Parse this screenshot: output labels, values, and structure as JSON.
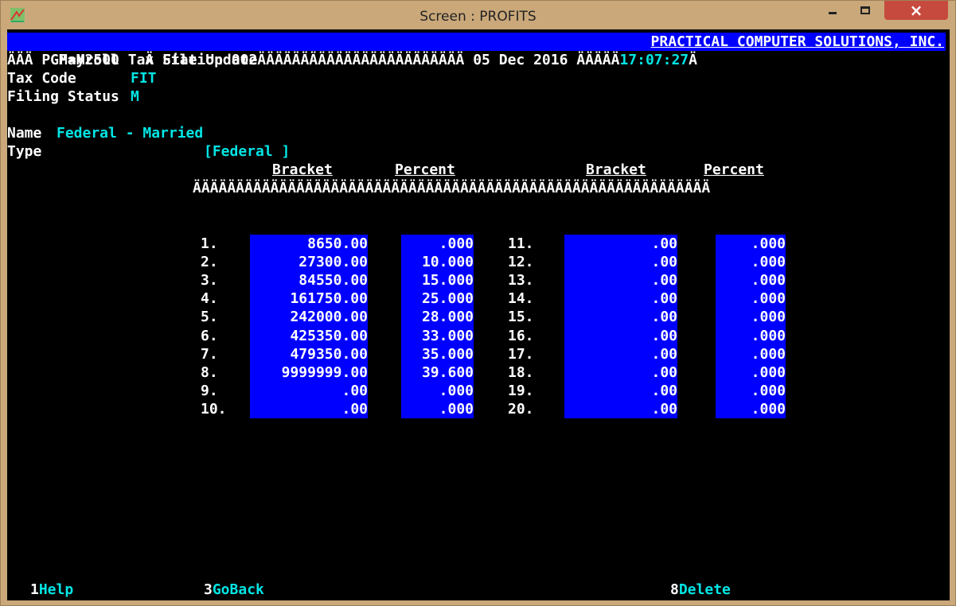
{
  "window": {
    "title": "Screen : PROFITS",
    "close_label": "×"
  },
  "header": {
    "title": "Payroll Tax File Update",
    "company": "PRACTICAL COMPUTER SOLUTIONS, INC."
  },
  "status_line": {
    "pgm": "ÄÄÄ PGM=M2500",
    "station": "Ä Station 002ÄÄÄÄÄÄÄÄÄÄÄÄÄÄÄÄÄÄÄÄÄÄÄÄ",
    "date": "05 Dec 2016 ÄÄÄÄÄ",
    "time": "17:07:27",
    "end": "Ä"
  },
  "fields": {
    "tax_code_label": "Tax Code",
    "tax_code_value": "FIT",
    "filing_status_label": "Filing Status",
    "filing_status_value": "M",
    "name_label": "Name",
    "name_value": "Federal - Married",
    "type_label": "Type",
    "type_value": "[Federal ]"
  },
  "table": {
    "bracket_header": "Bracket",
    "percent_header": "Percent",
    "bracket_header_2": "Bracket",
    "percent_header_2": "Percent",
    "separator": "ÄÄÄÄÄÄÄÄÄÄÄÄÄÄÄÄÄÄÄÄÄÄÄÄÄÄÄÄÄÄÄÄÄÄÄÄÄÄÄÄÄÄÄÄÄÄÄÄÄÄÄÄÄÄÄÄÄÄÄÄ",
    "rows_left": [
      {
        "num": "1.",
        "bracket": "8650.00",
        "percent": ".000"
      },
      {
        "num": "2.",
        "bracket": "27300.00",
        "percent": "10.000"
      },
      {
        "num": "3.",
        "bracket": "84550.00",
        "percent": "15.000"
      },
      {
        "num": "4.",
        "bracket": "161750.00",
        "percent": "25.000"
      },
      {
        "num": "5.",
        "bracket": "242000.00",
        "percent": "28.000"
      },
      {
        "num": "6.",
        "bracket": "425350.00",
        "percent": "33.000"
      },
      {
        "num": "7.",
        "bracket": "479350.00",
        "percent": "35.000"
      },
      {
        "num": "8.",
        "bracket": "9999999.00",
        "percent": "39.600"
      },
      {
        "num": "9.",
        "bracket": ".00",
        "percent": ".000"
      },
      {
        "num": "10.",
        "bracket": ".00",
        "percent": ".000"
      }
    ],
    "rows_right": [
      {
        "num": "11.",
        "bracket": ".00",
        "percent": ".000"
      },
      {
        "num": "12.",
        "bracket": ".00",
        "percent": ".000"
      },
      {
        "num": "13.",
        "bracket": ".00",
        "percent": ".000"
      },
      {
        "num": "14.",
        "bracket": ".00",
        "percent": ".000"
      },
      {
        "num": "15.",
        "bracket": ".00",
        "percent": ".000"
      },
      {
        "num": "16.",
        "bracket": ".00",
        "percent": ".000"
      },
      {
        "num": "17.",
        "bracket": ".00",
        "percent": ".000"
      },
      {
        "num": "18.",
        "bracket": ".00",
        "percent": ".000"
      },
      {
        "num": "19.",
        "bracket": ".00",
        "percent": ".000"
      },
      {
        "num": "20.",
        "bracket": ".00",
        "percent": ".000"
      }
    ]
  },
  "function_keys": [
    {
      "key": "1",
      "label": "Help"
    },
    {
      "key": "3",
      "label": "GoBack"
    },
    {
      "key": "8",
      "label": "Delete"
    }
  ],
  "colors": {
    "terminal_bg": "#000000",
    "field_bg": "#0000ff",
    "label_text": "#ffffff",
    "value_text": "#00e5e5",
    "close_button": "#c74a3f",
    "window_frame": "#caa87a"
  }
}
